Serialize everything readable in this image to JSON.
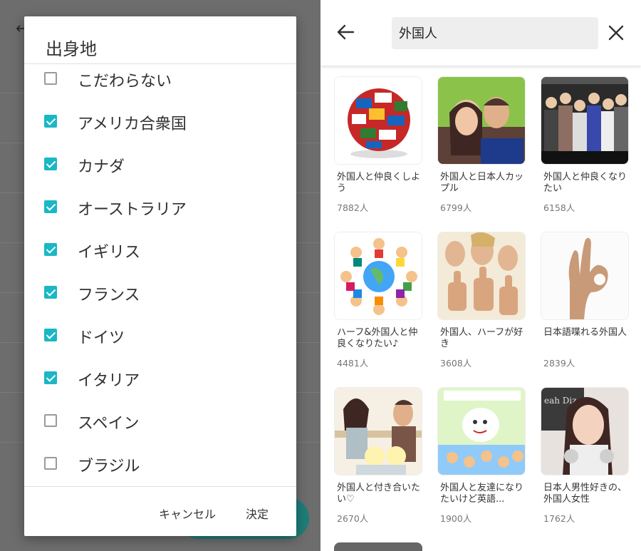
{
  "dialog": {
    "title": "出身地",
    "options": [
      {
        "label": "こだわらない",
        "checked": false
      },
      {
        "label": "アメリカ合衆国",
        "checked": true
      },
      {
        "label": "カナダ",
        "checked": true
      },
      {
        "label": "オーストラリア",
        "checked": true
      },
      {
        "label": "イギリス",
        "checked": true
      },
      {
        "label": "フランス",
        "checked": true
      },
      {
        "label": "ドイツ",
        "checked": true
      },
      {
        "label": "イタリア",
        "checked": true
      },
      {
        "label": "スペイン",
        "checked": false
      },
      {
        "label": "ブラジル",
        "checked": false
      }
    ],
    "cancel_label": "キャンセル",
    "ok_label": "決定",
    "accent_color": "#19b8c4"
  },
  "search": {
    "query": "外国人",
    "back_icon": "arrow-left-icon",
    "close_icon": "close-icon"
  },
  "results": [
    {
      "title": "外国人と仲良くしよう",
      "count": "7882人",
      "image": "globe-flags"
    },
    {
      "title": "外国人と日本人カップル",
      "count": "6799人",
      "image": "couple-kiss"
    },
    {
      "title": "外国人と仲良くなりたい",
      "count": "6158人",
      "image": "group-people"
    },
    {
      "title": "ハーフ&外国人と仲良くなりたい♪",
      "count": "4481人",
      "image": "kids-around-globe"
    },
    {
      "title": "外国人、ハーフが好き",
      "count": "3608人",
      "image": "thumbs-up-group"
    },
    {
      "title": "日本語喋れる外国人",
      "count": "2839人",
      "image": "ok-hand"
    },
    {
      "title": "外国人と付き合いたい♡",
      "count": "2670人",
      "image": "cafe-couple"
    },
    {
      "title": "外国人と友達になりたいけど英語...",
      "count": "1900人",
      "image": "cartoon-collage"
    },
    {
      "title": "日本人男性好きの、外国人女性",
      "count": "1762人",
      "image": "woman-portrait"
    }
  ]
}
